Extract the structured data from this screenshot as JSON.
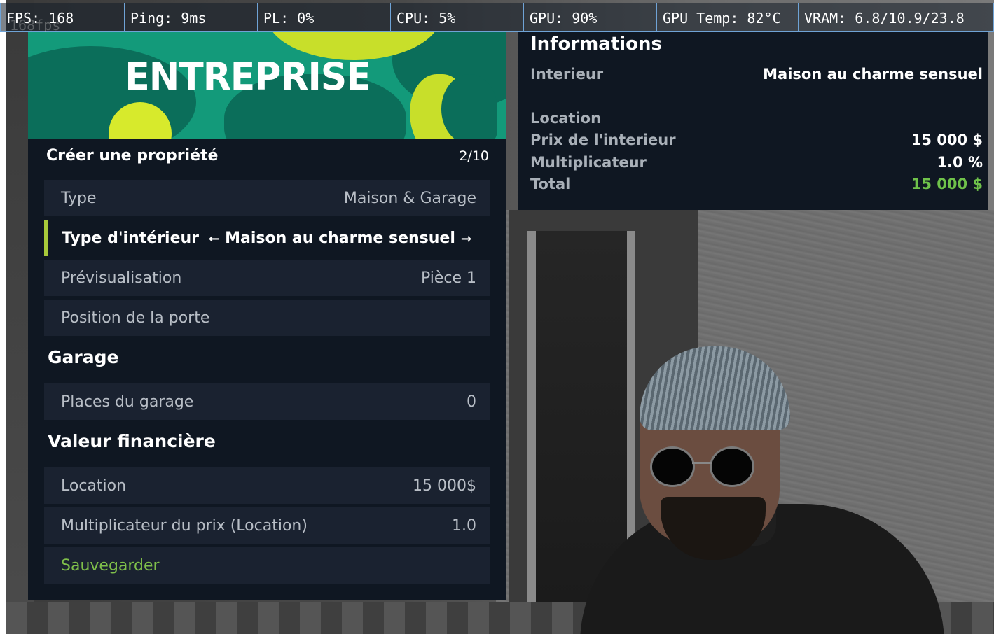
{
  "hud": {
    "fps": "FPS: 168",
    "fps_ghost": "168fps",
    "ping": "Ping: 9ms",
    "pl": "PL: 0%",
    "cpu": "CPU: 5%",
    "gpu": "GPU: 90%",
    "gpu_temp": "GPU Temp: 82°C",
    "vram": "VRAM: 6.8/10.9/23.8"
  },
  "menu": {
    "banner_title": "ENTREPRISE",
    "title": "Créer une propriété",
    "counter": "2/10",
    "rows": [
      {
        "label": "Type",
        "value": "Maison & Garage"
      },
      {
        "label": "Type d'intérieur",
        "value": "Maison au charme sensuel",
        "arrow_left": "←",
        "arrow_right": "→"
      },
      {
        "label": "Prévisualisation",
        "value": "Pièce 1"
      },
      {
        "label": "Position de la porte",
        "value": ""
      }
    ],
    "garage_section": "Garage",
    "garage_rows": [
      {
        "label": "Places du garage",
        "value": "0"
      }
    ],
    "finance_section": "Valeur financière",
    "finance_rows": [
      {
        "label": "Location",
        "value": "15 000$"
      },
      {
        "label": "Multiplicateur du prix (Location)",
        "value": "1.0"
      }
    ],
    "save_label": "Sauvegarder",
    "colors": {
      "accent": "#a7c93a",
      "save": "#7fbf4a",
      "panel": "#0f1722"
    }
  },
  "info": {
    "title": "Informations",
    "interieur_label": "Interieur",
    "interieur_value": "Maison au charme sensuel",
    "location_label": "Location",
    "prix_label": "Prix de l'interieur",
    "prix_value": "15 000 $",
    "multiplicateur_label": "Multiplicateur",
    "multiplicateur_value": "1.0 %",
    "total_label": "Total",
    "total_value": "15 000 $",
    "colors": {
      "total": "#6fc24a"
    }
  }
}
